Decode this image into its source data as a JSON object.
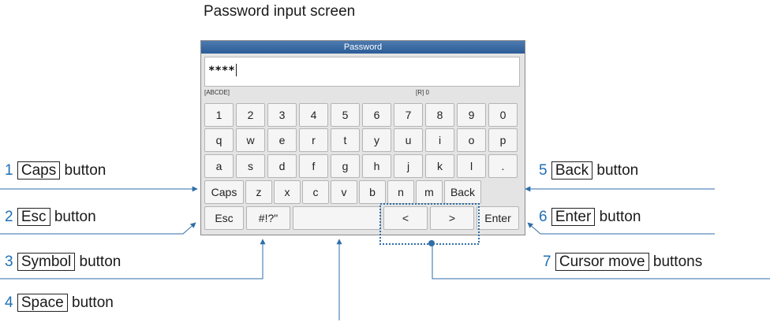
{
  "screen_title": "Password input screen",
  "device": {
    "title": "Password",
    "input_value": "****",
    "status_left": "[ABCDE]",
    "status_right": "[R] 0"
  },
  "keyboard": {
    "row1": [
      "1",
      "2",
      "3",
      "4",
      "5",
      "6",
      "7",
      "8",
      "9",
      "0"
    ],
    "row2": [
      "q",
      "w",
      "e",
      "r",
      "t",
      "y",
      "u",
      "i",
      "o",
      "p"
    ],
    "row3": [
      "a",
      "s",
      "d",
      "f",
      "g",
      "h",
      "j",
      "k",
      "l",
      "."
    ],
    "row4": [
      "Caps",
      "z",
      "x",
      "c",
      "v",
      "b",
      "n",
      "m",
      "Back"
    ],
    "row5": [
      "Esc",
      "#!?\"",
      "",
      "<",
      ">",
      "Enter"
    ]
  },
  "callouts": [
    {
      "num": "1",
      "key": "Caps",
      "suffix": "button"
    },
    {
      "num": "2",
      "key": "Esc",
      "suffix": "button"
    },
    {
      "num": "3",
      "key": "Symbol",
      "suffix": "button"
    },
    {
      "num": "4",
      "key": "Space",
      "suffix": "button"
    },
    {
      "num": "5",
      "key": "Back",
      "suffix": "button"
    },
    {
      "num": "6",
      "key": "Enter",
      "suffix": "button"
    },
    {
      "num": "7",
      "key": "Cursor move",
      "suffix": "buttons"
    }
  ],
  "colors": {
    "accent": "#1f6fb5",
    "titlebar": "#2b5c97"
  }
}
